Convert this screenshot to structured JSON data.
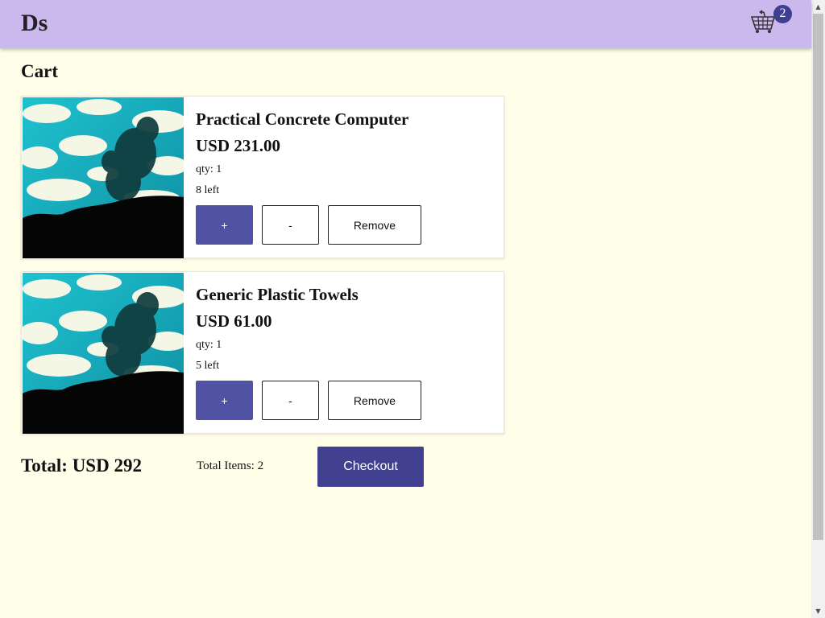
{
  "header": {
    "brand": "Ds",
    "cart_icon": "shopping-cart-icon",
    "cart_count": "2",
    "bar_color": "#cbb9ee",
    "badge_color": "#3f3f8f"
  },
  "page": {
    "title": "Cart",
    "background": "#fffee9"
  },
  "items": [
    {
      "name": "Practical Concrete Computer",
      "price": "USD 231.00",
      "qty": "qty: 1",
      "stock": "8 left",
      "plus_label": "+",
      "minus_label": "-",
      "remove_label": "Remove"
    },
    {
      "name": "Generic Plastic Towels",
      "price": "USD 61.00",
      "qty": "qty: 1",
      "stock": "5 left",
      "plus_label": "+",
      "minus_label": "-",
      "remove_label": "Remove"
    }
  ],
  "summary": {
    "total": "Total: USD 292",
    "total_items": "Total Items: 2",
    "checkout_label": "Checkout",
    "checkout_color": "#41418f"
  },
  "accent": "#5252a5"
}
